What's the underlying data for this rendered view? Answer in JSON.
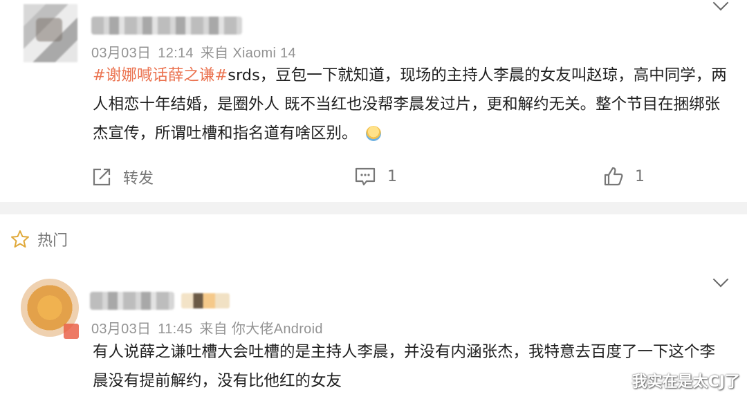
{
  "comment1": {
    "date": "03月03日",
    "time": "12:14",
    "source": "来自 Xiaomi 14",
    "topic": "#谢娜喊话薛之谦#",
    "text": "srds，豆包一下就知道，现场的主持人李晨的女友叫赵琼，高中同学，两人相恋十年结婚，是圈外人 既不当红也没帮李晨发过片，更和解约无关。整个节目在捆绑张杰宣传，所谓吐槽和指名道有啥区别。",
    "repost_label": "转发",
    "comment_count": "1",
    "like_count": "1"
  },
  "section": {
    "hot_label": "热门"
  },
  "comment2": {
    "date": "03月03日",
    "time": "11:45",
    "source": "来自 你大佬Android",
    "text": "有人说薛之谦吐槽大会吐槽的是主持人李晨，并没有内涵张杰，我特意去百度了一下这个李晨没有提前解约，没有比他红的女友"
  },
  "watermark": "我实在是太CJ了",
  "colors": {
    "topic": "#eb7350",
    "meta": "#939393",
    "divider": "#f2f2f2"
  }
}
